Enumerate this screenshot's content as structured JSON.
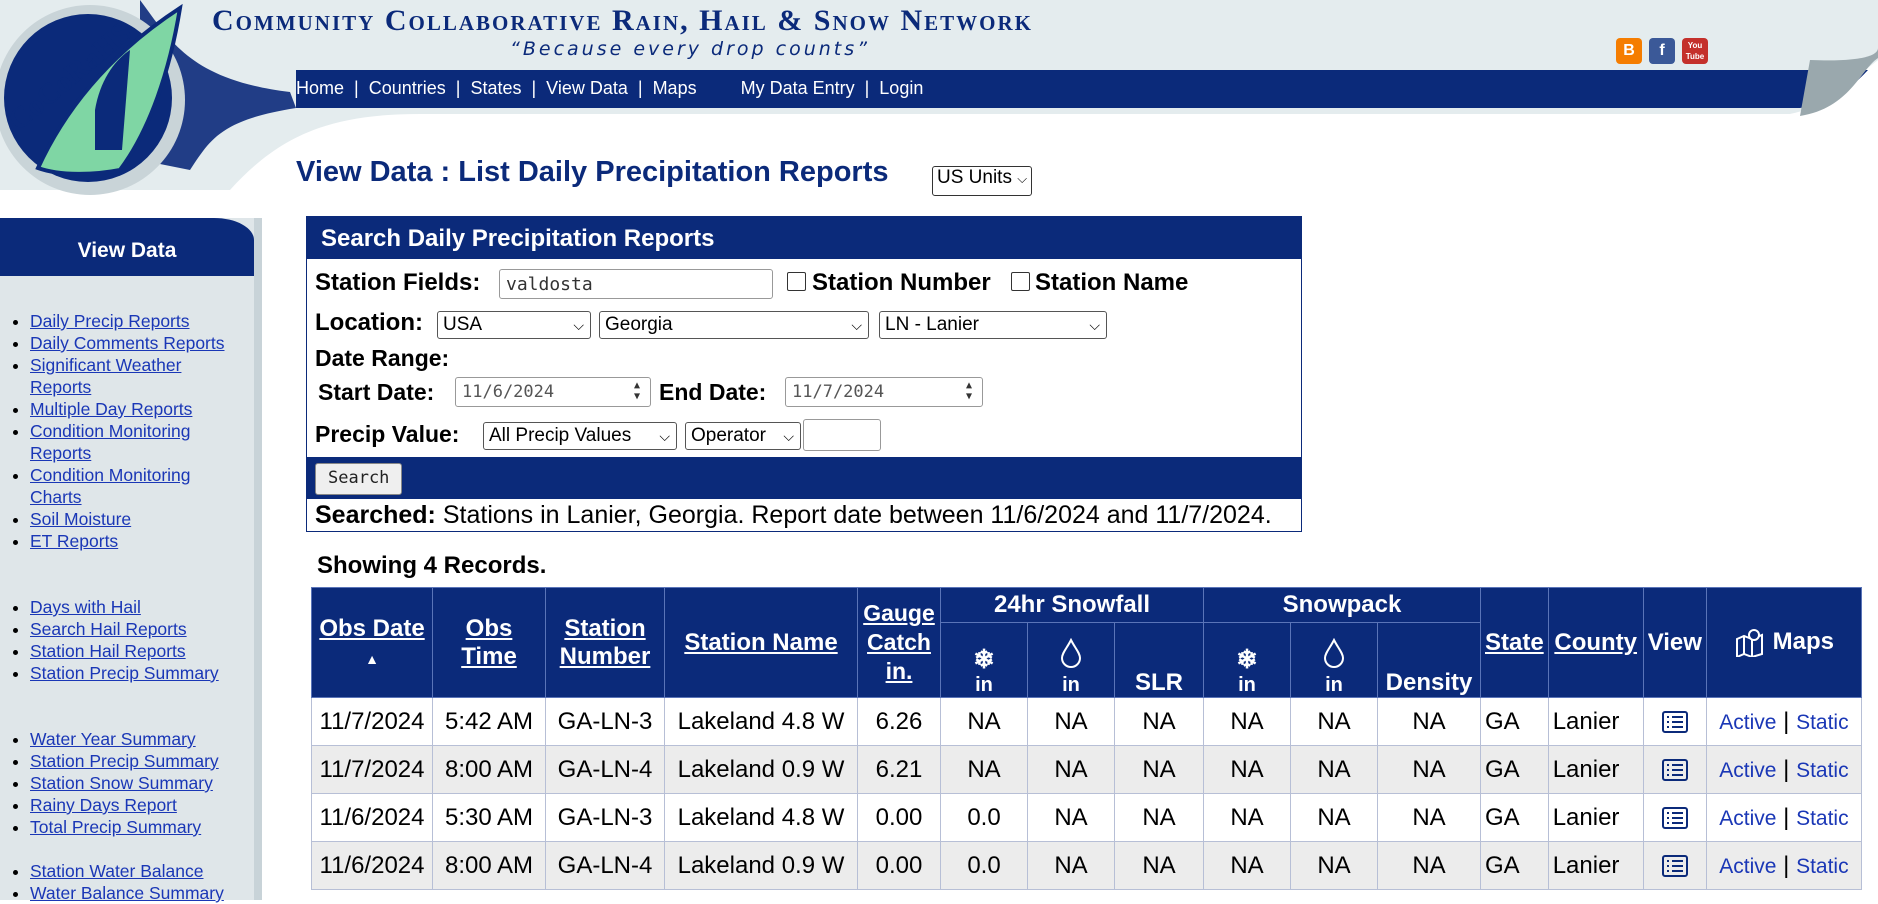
{
  "site": {
    "logo_text": "CoCoRaHS",
    "title": "Community Collaborative Rain, Hail & Snow Network",
    "tagline": "“Because every drop counts”"
  },
  "top_nav": {
    "home": "Home",
    "countries": "Countries",
    "states": "States",
    "view_data": "View Data",
    "maps": "Maps",
    "my_data_entry": "My Data Entry",
    "login": "Login",
    "sep": "|"
  },
  "social": {
    "blogger": "B",
    "facebook": "f",
    "youtube": "You Tube"
  },
  "sidebar": {
    "heading": "View Data",
    "group1": [
      "Daily Precip Reports",
      "Daily Comments Reports",
      "Significant Weather Reports",
      "Multiple Day Reports",
      "Condition Monitoring Reports",
      "Condition Monitoring Charts",
      "Soil Moisture",
      "ET Reports"
    ],
    "group2": [
      "Days with Hail",
      "Search Hail Reports",
      "Station Hail Reports",
      "Station Precip Summary"
    ],
    "group3": [
      "Water Year Summary",
      "Station Precip Summary",
      "Station Snow Summary",
      "Rainy Days Report",
      "Total Precip Summary"
    ],
    "group4": [
      "Station Water Balance",
      "Water Balance Summary"
    ]
  },
  "page": {
    "title": "View Data : List Daily Precipitation Reports",
    "units": "US Units"
  },
  "search": {
    "heading": "Search Daily Precipitation Reports",
    "station_fields_label": "Station Fields:",
    "station_fields_value": "valdosta",
    "station_number_label": "Station Number",
    "station_name_label": "Station Name",
    "location_label": "Location:",
    "country": "USA",
    "state": "Georgia",
    "county": "LN - Lanier",
    "date_range_label": "Date Range:",
    "start_date_label": "Start Date:",
    "start_date": "11/6/2024",
    "end_date_label": "End Date:",
    "end_date": "11/7/2024",
    "precip_value_label": "Precip Value:",
    "precip_value": "All Precip Values",
    "operator": "Operator",
    "button": "Search",
    "searched_label": "Searched:",
    "searched_text": "Stations in Lanier, Georgia. Report date between 11/6/2024 and 11/7/2024."
  },
  "results": {
    "count_text": "Showing 4 Records.",
    "headers": {
      "obs_date": "Obs Date",
      "sort_arrow": "▲",
      "obs_time": "Obs Time",
      "station_number": "Station Number",
      "station_name": "Station Name",
      "gauge_catch": "Gauge Catch in.",
      "snowfall": "24hr Snowfall",
      "snowpack": "Snowpack",
      "state": "State",
      "county": "County",
      "view": "View",
      "maps": "Maps",
      "unit_in": "in",
      "slr": "SLR",
      "density": "Density"
    },
    "rows": [
      {
        "date": "11/7/2024",
        "time": "5:42 AM",
        "num": "GA-LN-3",
        "name": "Lakeland 4.8 W",
        "catch": "6.26",
        "sf_in": "NA",
        "sf_water": "NA",
        "slr": "NA",
        "sp_in": "NA",
        "sp_water": "NA",
        "density": "NA",
        "state": "GA",
        "county": "Lanier"
      },
      {
        "date": "11/7/2024",
        "time": "8:00 AM",
        "num": "GA-LN-4",
        "name": "Lakeland 0.9 W",
        "catch": "6.21",
        "sf_in": "NA",
        "sf_water": "NA",
        "slr": "NA",
        "sp_in": "NA",
        "sp_water": "NA",
        "density": "NA",
        "state": "GA",
        "county": "Lanier"
      },
      {
        "date": "11/6/2024",
        "time": "5:30 AM",
        "num": "GA-LN-3",
        "name": "Lakeland 4.8 W",
        "catch": "0.00",
        "sf_in": "0.0",
        "sf_water": "NA",
        "slr": "NA",
        "sp_in": "NA",
        "sp_water": "NA",
        "density": "NA",
        "state": "GA",
        "county": "Lanier"
      },
      {
        "date": "11/6/2024",
        "time": "8:00 AM",
        "num": "GA-LN-4",
        "name": "Lakeland 0.9 W",
        "catch": "0.00",
        "sf_in": "0.0",
        "sf_water": "NA",
        "slr": "NA",
        "sp_in": "NA",
        "sp_water": "NA",
        "density": "NA",
        "state": "GA",
        "county": "Lanier"
      }
    ],
    "map_links": {
      "active": "Active",
      "sep": "|",
      "static": "Static"
    }
  },
  "colors": {
    "brand_blue": "#0b2a7a",
    "link_blue": "#1a37b6",
    "logo_green": "#7fd6a4"
  }
}
